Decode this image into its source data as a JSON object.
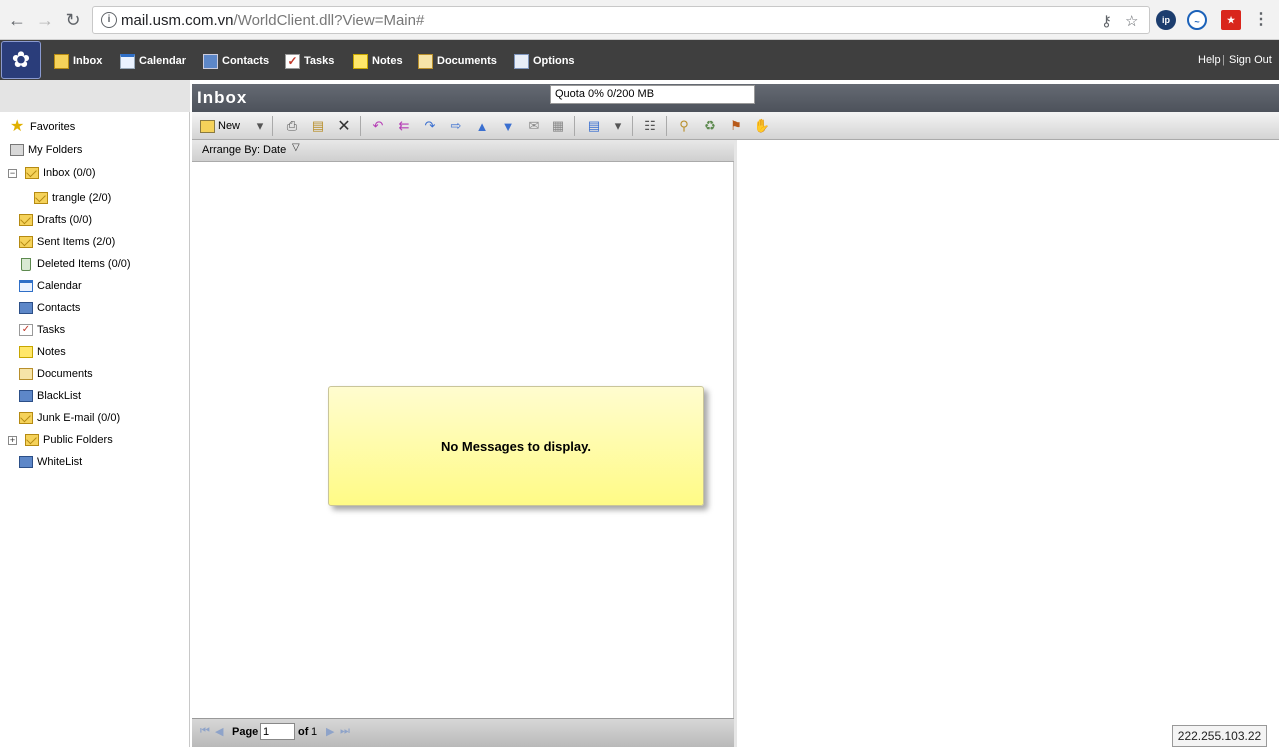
{
  "browser": {
    "url_host": "mail.usm.com.vn",
    "url_path": "/WorldClient.dll?View=Main#",
    "info_glyph": "i"
  },
  "nav": {
    "items": [
      {
        "label": "Inbox",
        "icon": "inbox-icon"
      },
      {
        "label": "Calendar",
        "icon": "calendar-icon"
      },
      {
        "label": "Contacts",
        "icon": "contacts-icon"
      },
      {
        "label": "Tasks",
        "icon": "tasks-icon"
      },
      {
        "label": "Notes",
        "icon": "notes-icon"
      },
      {
        "label": "Documents",
        "icon": "documents-icon"
      },
      {
        "label": "Options",
        "icon": "options-icon"
      }
    ],
    "help": "Help",
    "separator": "|",
    "sign_out": "Sign Out"
  },
  "title": {
    "text": "Inbox",
    "quota": "Quota 0% 0/200 MB"
  },
  "toolbar": {
    "new_label": "New"
  },
  "sidebar": {
    "items": [
      {
        "label": "Favorites",
        "icon": "star-icon"
      },
      {
        "label": "My Folders",
        "icon": "folders-icon"
      },
      {
        "label": "Inbox (0/0)",
        "icon": "envelope-icon",
        "expander": "−"
      },
      {
        "label": "trangle (2/0)",
        "icon": "envelope-icon"
      },
      {
        "label": "Drafts (0/0)",
        "icon": "envelope-icon"
      },
      {
        "label": "Sent Items (2/0)",
        "icon": "envelope-icon"
      },
      {
        "label": "Deleted Items (0/0)",
        "icon": "trash-icon"
      },
      {
        "label": "Calendar",
        "icon": "calendar-icon"
      },
      {
        "label": "Contacts",
        "icon": "address-book-icon"
      },
      {
        "label": "Tasks",
        "icon": "task-icon"
      },
      {
        "label": "Notes",
        "icon": "note-icon"
      },
      {
        "label": "Documents",
        "icon": "documents-icon"
      },
      {
        "label": "BlackList",
        "icon": "address-book-icon"
      },
      {
        "label": "Junk E-mail (0/0)",
        "icon": "envelope-icon"
      },
      {
        "label": "Public Folders",
        "icon": "envelope-icon",
        "expander": "+"
      },
      {
        "label": "WhiteList",
        "icon": "address-book-icon"
      }
    ]
  },
  "list": {
    "arrange_label": "Arrange By:",
    "arrange_value": "Date",
    "empty_message": "No Messages to display."
  },
  "pager": {
    "page_label": "Page",
    "page_value": "1",
    "of_label": "of",
    "total": "1"
  },
  "status": {
    "ip": "222.255.103.22"
  }
}
